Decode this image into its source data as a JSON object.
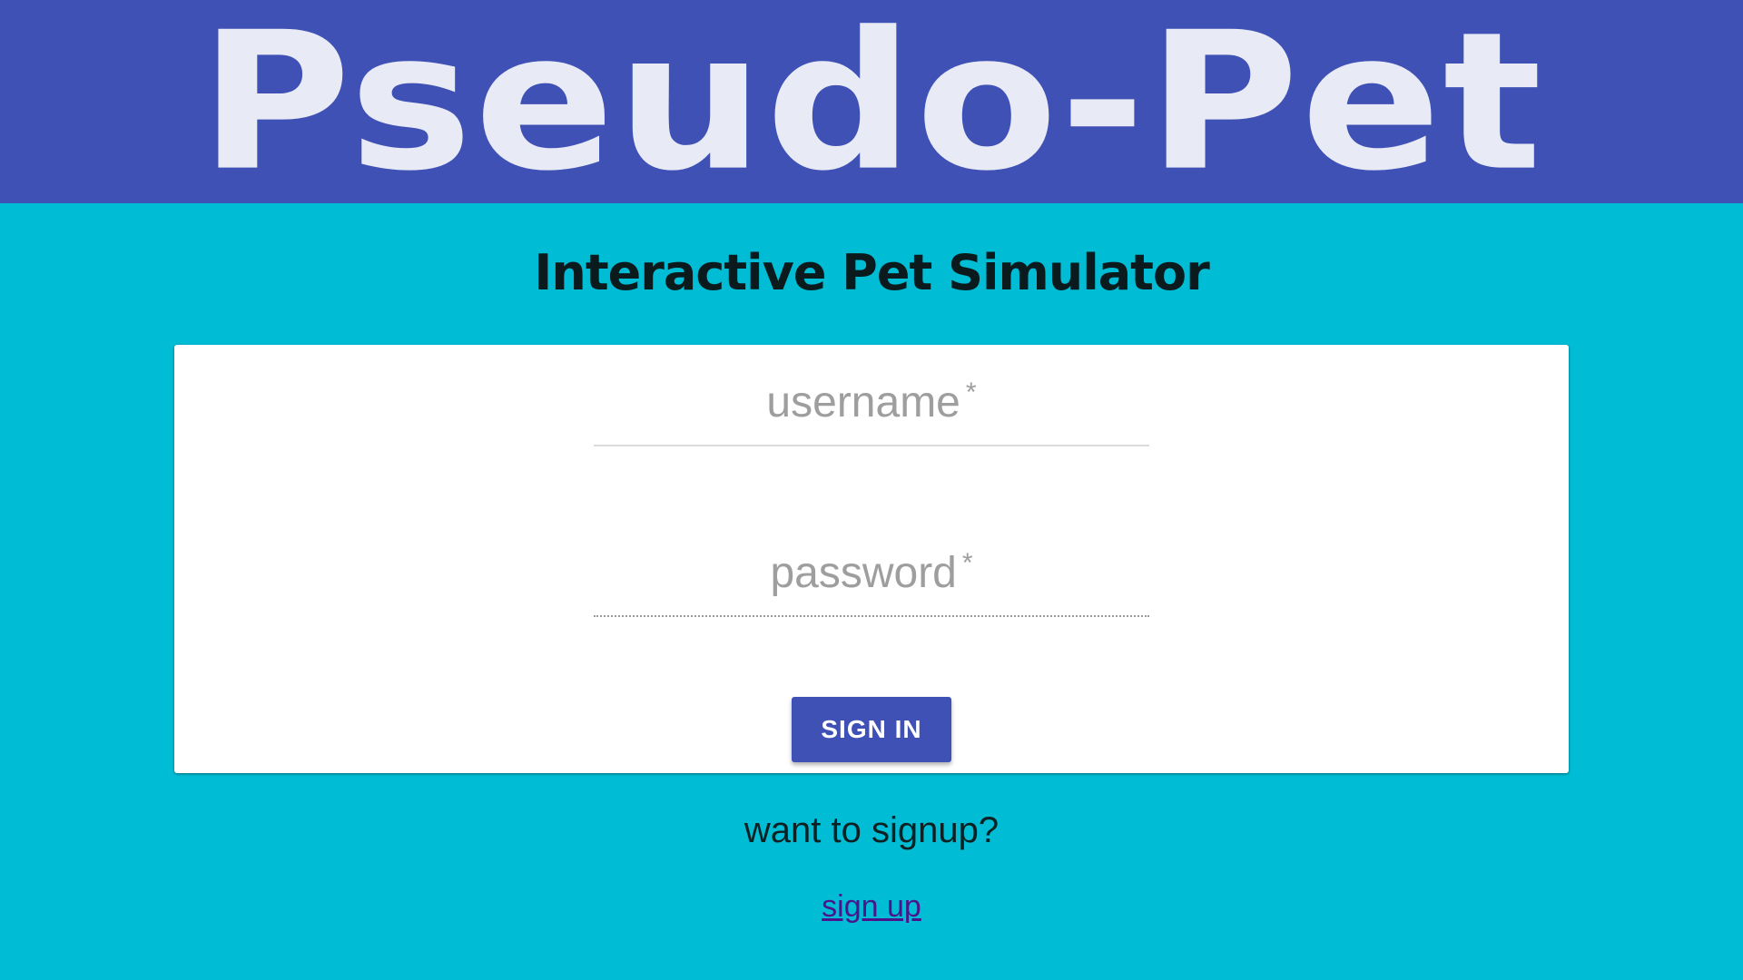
{
  "header": {
    "app_title": "Pseudo-Pet"
  },
  "subtitle": "Interactive Pet Simulator",
  "login_form": {
    "username": {
      "label": "username",
      "required_marker": "*",
      "value": ""
    },
    "password": {
      "label": "password",
      "required_marker": "*",
      "value": ""
    },
    "signin_label": "SIGN IN"
  },
  "signup": {
    "prompt": "want to signup?",
    "link_label": "sign up"
  },
  "colors": {
    "header_bg": "#3f51b5",
    "page_bg": "#00bcd4",
    "title_text": "#e8eaf6",
    "button_bg": "#3f51b5",
    "link": "#4a148c"
  }
}
